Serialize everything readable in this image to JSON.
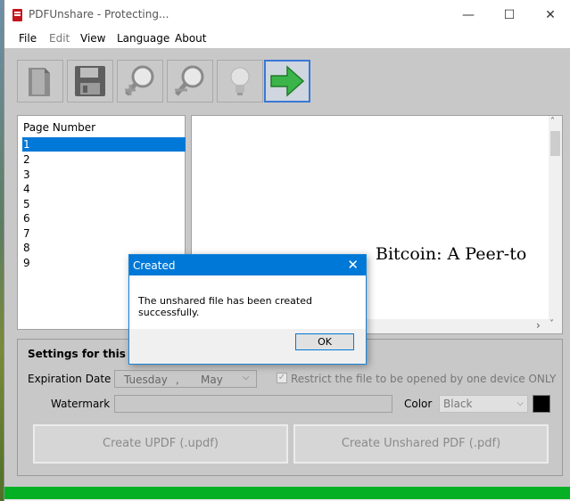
{
  "window": {
    "title": "PDFUnshare - Protecting...",
    "minimize_glyph": "—",
    "maximize_glyph": "☐",
    "close_glyph": "✕"
  },
  "menu": [
    "File",
    "Edit",
    "View",
    "Language",
    "About"
  ],
  "toolbar": {
    "icons": [
      "open-document-icon",
      "save-icon",
      "zoom-in-icon",
      "zoom-out-icon",
      "lightbulb-icon",
      "green-arrow-icon"
    ],
    "accent": "#3a78d6"
  },
  "pages": {
    "header": "Page Number",
    "items": [
      "1",
      "2",
      "3",
      "4",
      "5",
      "6",
      "7",
      "8",
      "9"
    ],
    "selected": "1"
  },
  "preview": {
    "text": "Bitcoin: A Peer-to",
    "scroll_up": "˄",
    "scroll_right": "›",
    "scroll_down": "˅"
  },
  "settings": {
    "title": "Settings for this Do",
    "expiration_label": "Expiration Date",
    "date_day": "Tuesday",
    "date_sep": ",",
    "date_month": "May",
    "restrict_label": "Restrict the file to be opened by one device ONLY",
    "check_mark": "✓",
    "watermark_label": "Watermark",
    "watermark_value": "",
    "color_label": "Color",
    "color_value": "Black",
    "create_updf": "Create UPDF (.updf)",
    "create_unshared": "Create Unshared PDF (.pdf)"
  },
  "progress": {
    "value": 1.0,
    "color": "#06b025"
  },
  "dialog": {
    "title": "Created",
    "close_glyph": "✕",
    "message": "The unshared file has been created successfully.",
    "ok": "OK"
  }
}
